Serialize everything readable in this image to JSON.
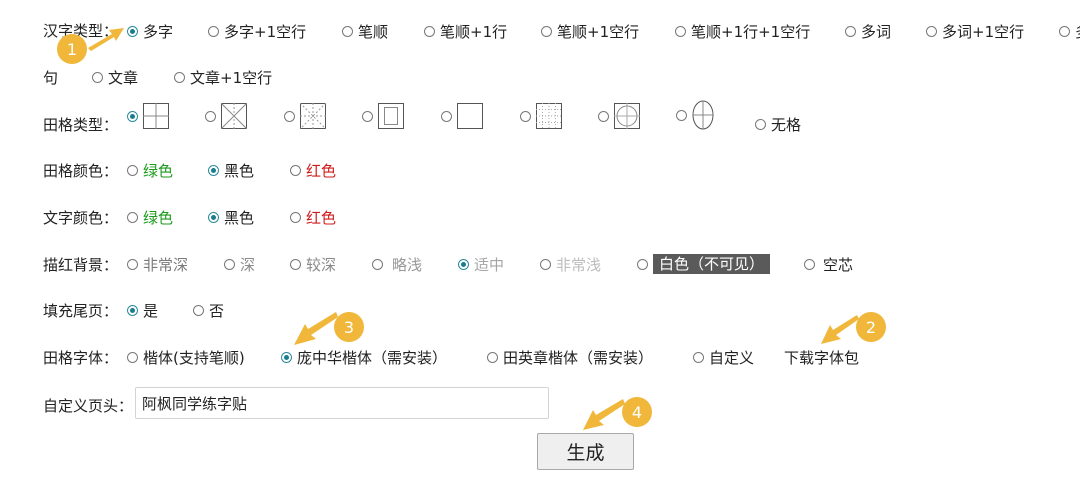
{
  "char_type": {
    "label": "汉字类型：",
    "options": [
      "多字",
      "多字+1空行",
      "笔顺",
      "笔顺+1行",
      "笔顺+1空行",
      "笔顺+1行+1空行",
      "多词",
      "多词+1空行",
      "多"
    ],
    "options_row2_prefix": "句",
    "options_row2": [
      "文章",
      "文章+1空行"
    ],
    "selected_index": 0
  },
  "grid_type": {
    "label": "田格类型：",
    "grid_icons": [
      "tian-grid-icon",
      "mi-grid-icon",
      "mi-dotted-grid-icon",
      "inner-rect-grid-icon",
      "square-grid-icon",
      "dotted-fine-grid-icon",
      "round-tian-grid-icon",
      "oval-grid-icon"
    ],
    "none_label": "无格",
    "selected_index": 0
  },
  "grid_color": {
    "label": "田格颜色：",
    "options": [
      "绿色",
      "黑色",
      "红色"
    ],
    "selected_index": 1
  },
  "text_color": {
    "label": "文字颜色：",
    "options": [
      "绿色",
      "黑色",
      "红色"
    ],
    "selected_index": 1
  },
  "trace_bg": {
    "label": "描红背景：",
    "options": [
      "非常深",
      "深",
      "较深",
      "略浅",
      "适中",
      "非常浅",
      "白色（不可见）",
      "空芯"
    ],
    "selected_index": 4
  },
  "fill_tail": {
    "label": "填充尾页：",
    "options": [
      "是",
      "否"
    ],
    "selected_index": 0
  },
  "grid_font": {
    "label": "田格字体：",
    "options": [
      "楷体(支持笔顺)",
      "庞中华楷体（需安装）",
      "田英章楷体（需安装）",
      "自定义"
    ],
    "selected_index": 1,
    "download_link": "下载字体包"
  },
  "custom_header": {
    "label": "自定义页头：",
    "value": "阿枫同学练字贴"
  },
  "generate_button": "生成",
  "badges": [
    "1",
    "2",
    "3",
    "4"
  ],
  "colors": {
    "accent": "#1a7d8e",
    "badge": "#f0b73a",
    "green": "#1c9b1c",
    "red": "#d11b1b"
  }
}
